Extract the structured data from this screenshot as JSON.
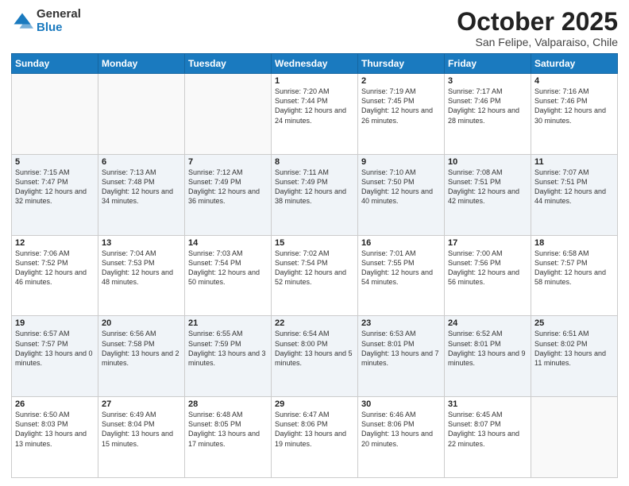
{
  "logo": {
    "general": "General",
    "blue": "Blue"
  },
  "header": {
    "month": "October 2025",
    "location": "San Felipe, Valparaiso, Chile"
  },
  "weekdays": [
    "Sunday",
    "Monday",
    "Tuesday",
    "Wednesday",
    "Thursday",
    "Friday",
    "Saturday"
  ],
  "rows": [
    [
      {
        "day": "",
        "empty": true
      },
      {
        "day": "",
        "empty": true
      },
      {
        "day": "",
        "empty": true
      },
      {
        "day": "1",
        "sunrise": "7:20 AM",
        "sunset": "7:44 PM",
        "daylight": "12 hours and 24 minutes."
      },
      {
        "day": "2",
        "sunrise": "7:19 AM",
        "sunset": "7:45 PM",
        "daylight": "12 hours and 26 minutes."
      },
      {
        "day": "3",
        "sunrise": "7:17 AM",
        "sunset": "7:46 PM",
        "daylight": "12 hours and 28 minutes."
      },
      {
        "day": "4",
        "sunrise": "7:16 AM",
        "sunset": "7:46 PM",
        "daylight": "12 hours and 30 minutes."
      }
    ],
    [
      {
        "day": "5",
        "sunrise": "7:15 AM",
        "sunset": "7:47 PM",
        "daylight": "12 hours and 32 minutes."
      },
      {
        "day": "6",
        "sunrise": "7:13 AM",
        "sunset": "7:48 PM",
        "daylight": "12 hours and 34 minutes."
      },
      {
        "day": "7",
        "sunrise": "7:12 AM",
        "sunset": "7:49 PM",
        "daylight": "12 hours and 36 minutes."
      },
      {
        "day": "8",
        "sunrise": "7:11 AM",
        "sunset": "7:49 PM",
        "daylight": "12 hours and 38 minutes."
      },
      {
        "day": "9",
        "sunrise": "7:10 AM",
        "sunset": "7:50 PM",
        "daylight": "12 hours and 40 minutes."
      },
      {
        "day": "10",
        "sunrise": "7:08 AM",
        "sunset": "7:51 PM",
        "daylight": "12 hours and 42 minutes."
      },
      {
        "day": "11",
        "sunrise": "7:07 AM",
        "sunset": "7:51 PM",
        "daylight": "12 hours and 44 minutes."
      }
    ],
    [
      {
        "day": "12",
        "sunrise": "7:06 AM",
        "sunset": "7:52 PM",
        "daylight": "12 hours and 46 minutes."
      },
      {
        "day": "13",
        "sunrise": "7:04 AM",
        "sunset": "7:53 PM",
        "daylight": "12 hours and 48 minutes."
      },
      {
        "day": "14",
        "sunrise": "7:03 AM",
        "sunset": "7:54 PM",
        "daylight": "12 hours and 50 minutes."
      },
      {
        "day": "15",
        "sunrise": "7:02 AM",
        "sunset": "7:54 PM",
        "daylight": "12 hours and 52 minutes."
      },
      {
        "day": "16",
        "sunrise": "7:01 AM",
        "sunset": "7:55 PM",
        "daylight": "12 hours and 54 minutes."
      },
      {
        "day": "17",
        "sunrise": "7:00 AM",
        "sunset": "7:56 PM",
        "daylight": "12 hours and 56 minutes."
      },
      {
        "day": "18",
        "sunrise": "6:58 AM",
        "sunset": "7:57 PM",
        "daylight": "12 hours and 58 minutes."
      }
    ],
    [
      {
        "day": "19",
        "sunrise": "6:57 AM",
        "sunset": "7:57 PM",
        "daylight": "13 hours and 0 minutes."
      },
      {
        "day": "20",
        "sunrise": "6:56 AM",
        "sunset": "7:58 PM",
        "daylight": "13 hours and 2 minutes."
      },
      {
        "day": "21",
        "sunrise": "6:55 AM",
        "sunset": "7:59 PM",
        "daylight": "13 hours and 3 minutes."
      },
      {
        "day": "22",
        "sunrise": "6:54 AM",
        "sunset": "8:00 PM",
        "daylight": "13 hours and 5 minutes."
      },
      {
        "day": "23",
        "sunrise": "6:53 AM",
        "sunset": "8:01 PM",
        "daylight": "13 hours and 7 minutes."
      },
      {
        "day": "24",
        "sunrise": "6:52 AM",
        "sunset": "8:01 PM",
        "daylight": "13 hours and 9 minutes."
      },
      {
        "day": "25",
        "sunrise": "6:51 AM",
        "sunset": "8:02 PM",
        "daylight": "13 hours and 11 minutes."
      }
    ],
    [
      {
        "day": "26",
        "sunrise": "6:50 AM",
        "sunset": "8:03 PM",
        "daylight": "13 hours and 13 minutes."
      },
      {
        "day": "27",
        "sunrise": "6:49 AM",
        "sunset": "8:04 PM",
        "daylight": "13 hours and 15 minutes."
      },
      {
        "day": "28",
        "sunrise": "6:48 AM",
        "sunset": "8:05 PM",
        "daylight": "13 hours and 17 minutes."
      },
      {
        "day": "29",
        "sunrise": "6:47 AM",
        "sunset": "8:06 PM",
        "daylight": "13 hours and 19 minutes."
      },
      {
        "day": "30",
        "sunrise": "6:46 AM",
        "sunset": "8:06 PM",
        "daylight": "13 hours and 20 minutes."
      },
      {
        "day": "31",
        "sunrise": "6:45 AM",
        "sunset": "8:07 PM",
        "daylight": "13 hours and 22 minutes."
      },
      {
        "day": "",
        "empty": true
      }
    ]
  ],
  "labels": {
    "sunrise": "Sunrise:",
    "sunset": "Sunset:",
    "daylight": "Daylight:"
  }
}
